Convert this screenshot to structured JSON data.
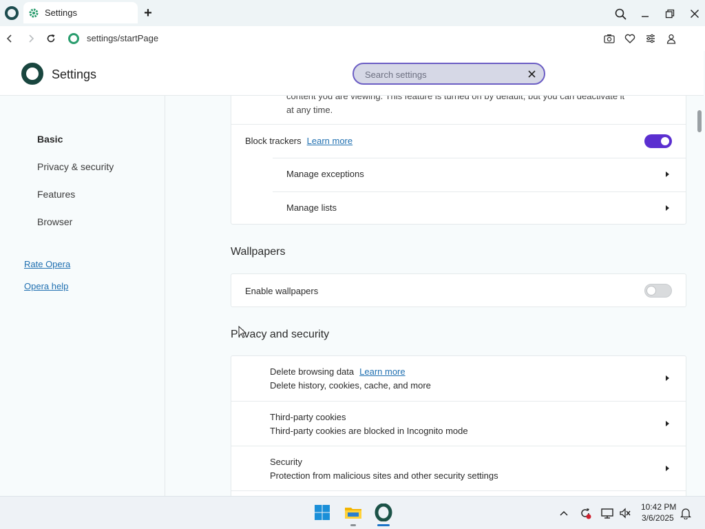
{
  "browser": {
    "tab_title": "Settings",
    "url": "settings/startPage"
  },
  "settings": {
    "title": "Settings",
    "search_placeholder": "Search settings"
  },
  "sidebar": {
    "items": [
      {
        "label": "Basic",
        "active": true
      },
      {
        "label": "Privacy & security",
        "active": false
      },
      {
        "label": "Features",
        "active": false
      },
      {
        "label": "Browser",
        "active": false
      }
    ],
    "links": [
      "Rate Opera",
      "Opera help"
    ]
  },
  "main": {
    "partial_desc_line1": "content you are viewing. This feature is turned on by default, but you can deactivate it",
    "partial_desc_line2": "at any time.",
    "block_trackers": {
      "label": "Block trackers",
      "link": "Learn more",
      "enabled": true
    },
    "manage_exceptions": "Manage exceptions",
    "manage_lists": "Manage lists",
    "wallpapers": {
      "heading": "Wallpapers",
      "enable_label": "Enable wallpapers",
      "enabled": false
    },
    "privacy": {
      "heading": "Privacy and security",
      "rows": [
        {
          "title": "Delete browsing data",
          "link": "Learn more",
          "subtitle": "Delete history, cookies, cache, and more"
        },
        {
          "title": "Third-party cookies",
          "subtitle": "Third-party cookies are blocked in Incognito mode"
        },
        {
          "title": "Security",
          "subtitle": "Protection from malicious sites and other security settings"
        }
      ]
    }
  },
  "taskbar": {
    "time": "10:42 PM",
    "date": "3/6/2025"
  },
  "colors": {
    "accent": "#5b2fd0",
    "link": "#1f6fb0",
    "search_border": "#6b5dc4"
  }
}
